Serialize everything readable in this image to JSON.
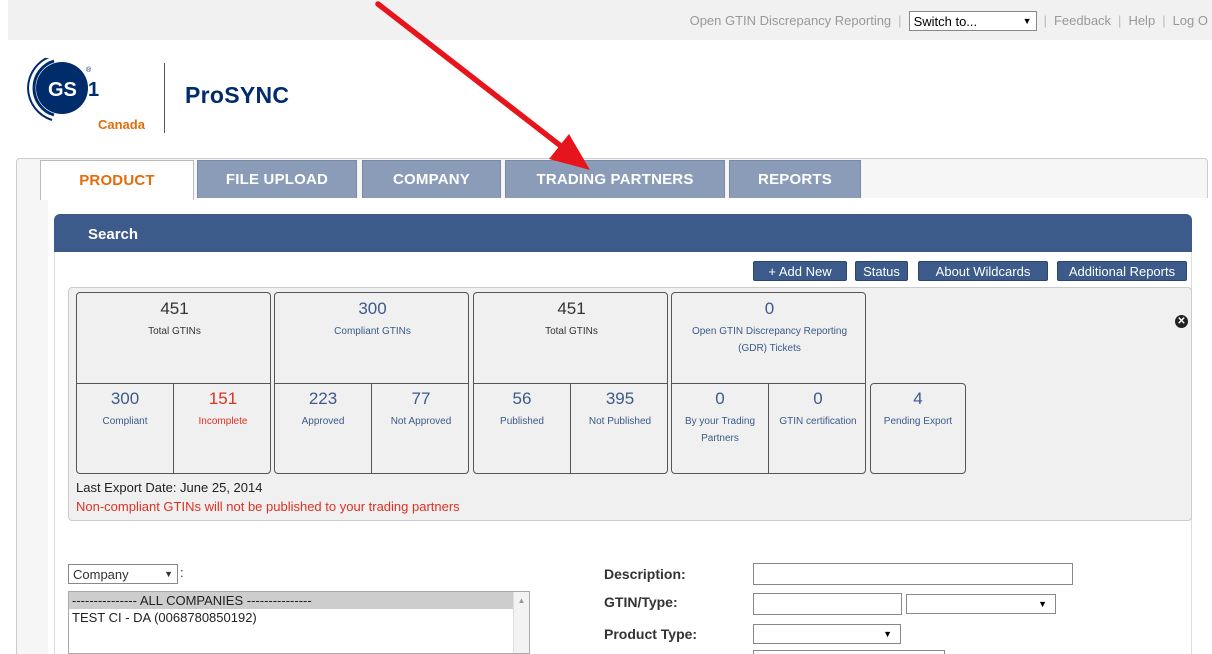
{
  "topbar": {
    "gdr_link": "Open GTIN Discrepancy Reporting",
    "switch_value": "Switch to...",
    "feedback": "Feedback",
    "help": "Help",
    "logout": "Log O"
  },
  "brand": {
    "logo_text": "GS1",
    "logo_sub": "Canada",
    "app_name": "ProSYNC"
  },
  "tabs": [
    {
      "label": "PRODUCT",
      "active": true
    },
    {
      "label": "FILE UPLOAD",
      "active": false
    },
    {
      "label": "COMPANY",
      "active": false
    },
    {
      "label": "TRADING PARTNERS",
      "active": false
    },
    {
      "label": "REPORTS",
      "active": false
    }
  ],
  "search": {
    "title": "Search",
    "buttons": {
      "add_new": "+ Add New",
      "status": "Status",
      "about_wildcards": "About Wildcards",
      "additional_reports": "Additional Reports"
    }
  },
  "stats": {
    "total": {
      "value": "451",
      "label": "Total GTINs"
    },
    "compliant_total": {
      "value": "300",
      "label": "Compliant GTINs"
    },
    "published_total": {
      "value": "451",
      "label": "Total GTINs"
    },
    "gdr": {
      "value": "0",
      "label1": "Open GTIN Discrepancy Reporting",
      "label2": "(GDR) Tickets"
    },
    "compliant": {
      "value": "300",
      "label": "Compliant"
    },
    "incomplete": {
      "value": "151",
      "label": "Incomplete"
    },
    "approved": {
      "value": "223",
      "label": "Approved"
    },
    "not_approved": {
      "value": "77",
      "label": "Not Approved"
    },
    "published": {
      "value": "56",
      "label": "Published"
    },
    "not_published": {
      "value": "395",
      "label": "Not Published"
    },
    "by_partners": {
      "value": "0",
      "label1": "By your Trading",
      "label2": "Partners"
    },
    "gtin_cert": {
      "value": "0",
      "label": "GTIN certification"
    },
    "pending": {
      "value": "4",
      "label": "Pending Export"
    },
    "last_export": "Last Export Date: June 25, 2014",
    "warning": "Non-compliant GTINs will not be published to your trading partners"
  },
  "filters": {
    "company_select": "Company",
    "company_list": [
      {
        "label": "--------------- ALL COMPANIES ---------------",
        "selected": true
      },
      {
        "label": "TEST CI - DA (0068780850192)",
        "selected": false
      }
    ],
    "description_label": "Description:",
    "gtin_type_label": "GTIN/Type:",
    "product_type_label": "Product Type:"
  },
  "colors": {
    "accent": "#3c5a8a",
    "tab_inactive": "#8a9cb8",
    "active_tab_text": "#e46c0a",
    "alert": "#e03020",
    "annotation_arrow": "#e8141b"
  }
}
